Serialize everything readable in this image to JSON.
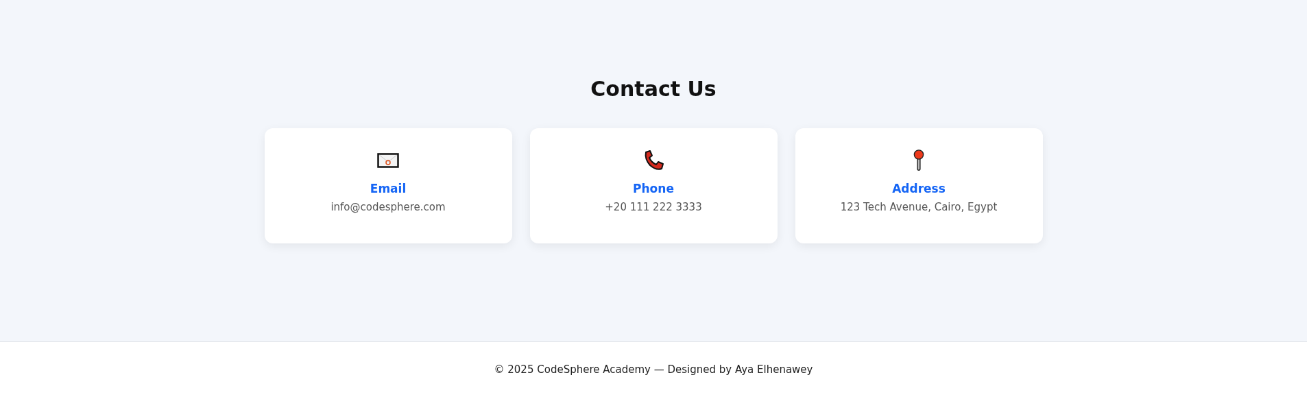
{
  "section": {
    "title": "Contact Us"
  },
  "cards": [
    {
      "kind": "email",
      "title": "Email",
      "value": "info@codesphere.com"
    },
    {
      "kind": "phone",
      "title": "Phone",
      "value": "+20 111 222 3333"
    },
    {
      "kind": "address",
      "title": "Address",
      "value": "123 Tech Avenue, Cairo, Egypt"
    }
  ],
  "footer": {
    "text": "© 2025 CodeSphere Academy — Designed by Aya Elhenawey"
  }
}
